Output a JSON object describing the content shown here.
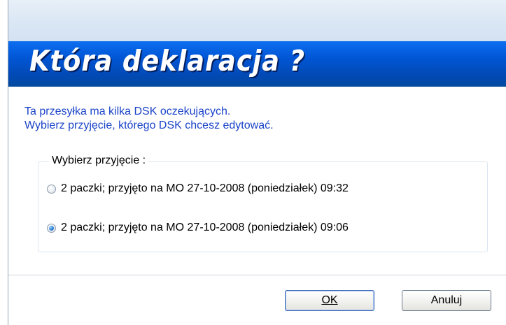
{
  "dialog": {
    "banner_title": "Która deklaracja ?",
    "info_line1": "Ta przesyłka ma kilka DSK oczekujących.",
    "info_line2": "Wybierz przyjęcie, którego DSK chcesz edytować.",
    "group_label": "Wybierz przyjęcie :",
    "options": [
      {
        "label": "2 paczki; przyjęto na MO 27-10-2008 (poniedziałek) 09:32",
        "checked": false
      },
      {
        "label": "2 paczki; przyjęto na MO 27-10-2008 (poniedziałek) 09:06",
        "checked": true
      }
    ],
    "ok_label": "OK",
    "cancel_label": "Anuluj"
  },
  "colors": {
    "banner": "#0157d6",
    "info_text": "#1b44c8",
    "titlebar": "#dbe6f3"
  }
}
